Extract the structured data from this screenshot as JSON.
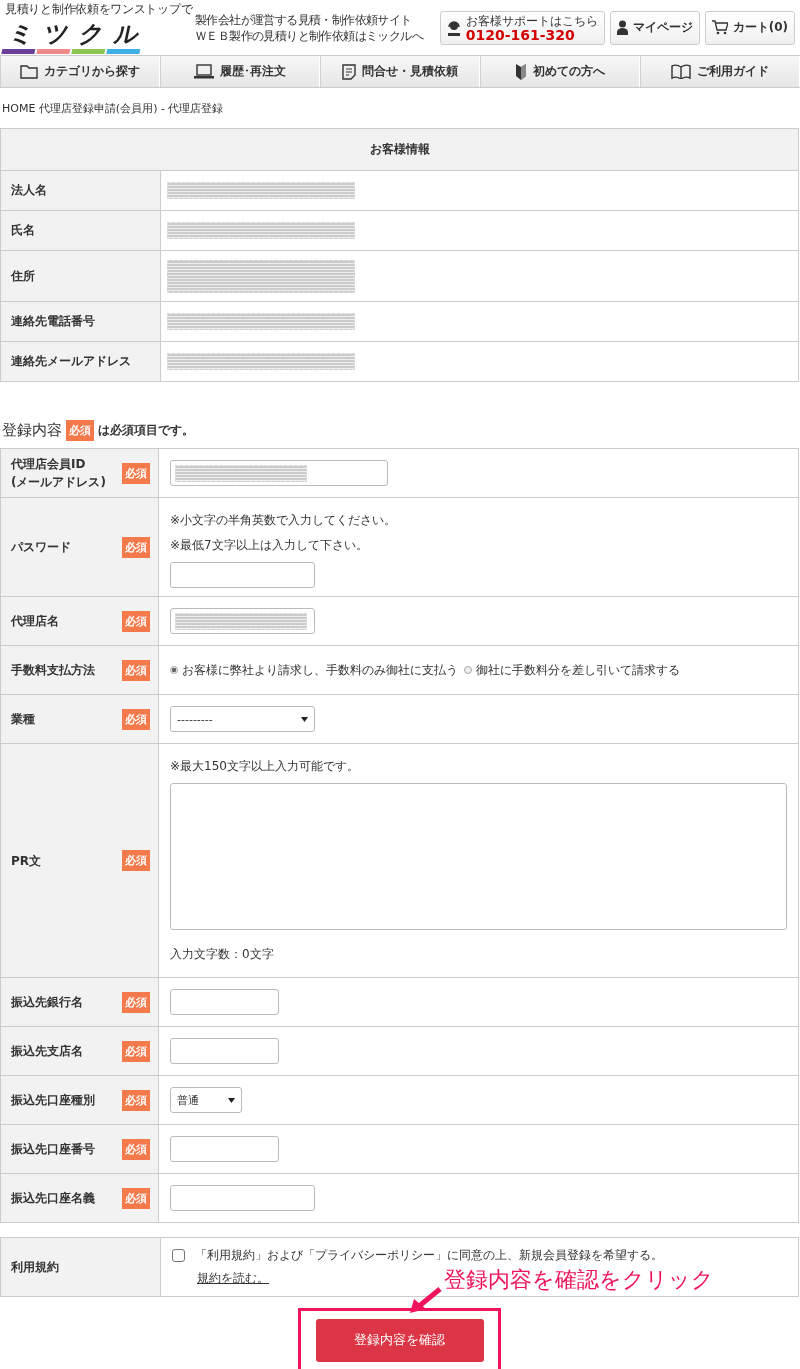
{
  "header": {
    "tagline": "見積りと制作依頼をワンストップで",
    "logo": [
      {
        "char": "ミ",
        "color": "#6a3f9a"
      },
      {
        "char": "ツ",
        "color": "#f08a8a"
      },
      {
        "char": "ク",
        "color": "#8cc751"
      },
      {
        "char": "ル",
        "color": "#3fb0e6"
      }
    ],
    "description": [
      "製作会社が運営する見積・制作依頼サイト",
      "ＷＥＢ製作の見積りと制作依頼はミックルへ"
    ],
    "support": {
      "label": "お客様サポートはこちら",
      "phone": "0120-161-320"
    },
    "mypage": "マイページ",
    "cart": "カート(0)"
  },
  "nav": [
    {
      "kind": "folder",
      "label": "カテゴリから探す"
    },
    {
      "kind": "laptop",
      "label": "履歴･再注文"
    },
    {
      "kind": "document",
      "label": "問合せ・見積依頼"
    },
    {
      "kind": "beginner",
      "label": "初めての方へ"
    },
    {
      "kind": "book",
      "label": "ご利用ガイド"
    }
  ],
  "breadcrumb": "HOME 代理店登録申請(会員用) - 代理店登録",
  "customer": {
    "title": "お客様情報",
    "rows": [
      {
        "label": "法人名",
        "kind": "single"
      },
      {
        "label": "氏名",
        "kind": "single"
      },
      {
        "label": "住所",
        "kind": "double"
      },
      {
        "label": "連絡先電話番号",
        "kind": "single"
      },
      {
        "label": "連絡先メールアドレス",
        "kind": "single"
      }
    ]
  },
  "registration": {
    "title": "登録内容",
    "badge": "必須",
    "legend": "は必須項目です。",
    "rows": [
      {
        "label": [
          "代理店会員ID",
          "(メールアドレス)"
        ],
        "badge": "必須",
        "kind": "wide_input",
        "redacted": true
      },
      {
        "label": [
          "パスワード"
        ],
        "badge": "必須",
        "kind": "input",
        "notes": [
          "※小文字の半角英数で入力してください。",
          "※最低7文字以上は入力して下さい。"
        ]
      },
      {
        "label": [
          "代理店名"
        ],
        "badge": "必須",
        "kind": "input",
        "redacted": true
      },
      {
        "label": [
          "手数料支払方法"
        ],
        "badge": "必須",
        "kind": "radio",
        "options": [
          {
            "label": "お客様に弊社より請求し、手数料のみ御社に支払う",
            "selected": true
          },
          {
            "label": "御社に手数料分を差し引いて請求する",
            "selected": false
          }
        ]
      },
      {
        "label": [
          "業種"
        ],
        "badge": "必須",
        "kind": "select",
        "value": "---------"
      },
      {
        "label": [
          "PR文"
        ],
        "badge": "必須",
        "kind": "textarea",
        "notes": [
          "※最大150文字以上入力可能です。"
        ],
        "count": "入力文字数：0文字"
      },
      {
        "label": [
          "振込先銀行名"
        ],
        "badge": "必須",
        "kind": "short_input"
      },
      {
        "label": [
          "振込先支店名"
        ],
        "badge": "必須",
        "kind": "short_input"
      },
      {
        "label": [
          "振込先口座種別"
        ],
        "badge": "必須",
        "kind": "short_select",
        "value": "普通"
      },
      {
        "label": [
          "振込先口座番号"
        ],
        "badge": "必須",
        "kind": "short_input"
      },
      {
        "label": [
          "振込先口座名義"
        ],
        "badge": "必須",
        "kind": "input"
      }
    ]
  },
  "terms": {
    "label": "利用規約",
    "checked": false,
    "text": "「利用規約」および「プライバシーポリシー」に同意の上、新規会員登録を希望する。",
    "link": "規約を読む。"
  },
  "submit": "登録内容を確認",
  "annotation": "登録内容を確認をクリック"
}
